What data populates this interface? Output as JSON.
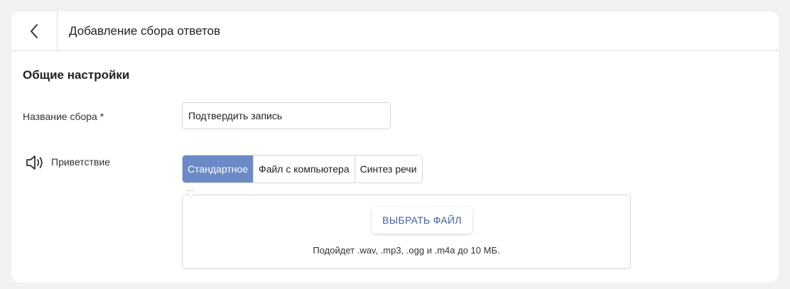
{
  "header": {
    "title": "Добавление сбора ответов",
    "back_icon": "chevron-left-icon"
  },
  "section": {
    "title": "Общие настройки"
  },
  "form": {
    "name_label": "Название сбора *",
    "name_value": "Подтвердить запись",
    "greeting_label": "Приветствие",
    "greeting_icon": "speaker-icon"
  },
  "tabs": [
    {
      "label": "Стандартное",
      "active": true
    },
    {
      "label": "Файл с компьютера",
      "active": false
    },
    {
      "label": "Синтез речи",
      "active": false
    }
  ],
  "upload": {
    "button_label": "ВЫБРАТЬ ФАЙЛ",
    "hint": "Подойдет .wav, .mp3, .ogg и .m4a до 10 МБ."
  },
  "colors": {
    "accent": "#6b8ac7",
    "button_text": "#3f5e9e",
    "background": "#f2f2f2"
  }
}
